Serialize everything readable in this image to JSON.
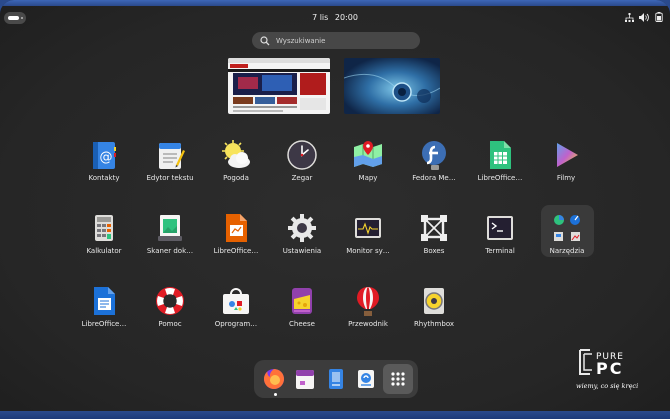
{
  "topbar": {
    "date": "7 lis",
    "time": "20:00",
    "icons": [
      "network-icon",
      "volume-icon",
      "battery-icon"
    ]
  },
  "search": {
    "placeholder": "Wyszukiwanie"
  },
  "apps": [
    {
      "label": "Kontakty",
      "icon": "contacts-icon"
    },
    {
      "label": "Edytor tekstu",
      "icon": "text-editor-icon"
    },
    {
      "label": "Pogoda",
      "icon": "weather-icon"
    },
    {
      "label": "Zegar",
      "icon": "clock-icon"
    },
    {
      "label": "Mapy",
      "icon": "maps-icon"
    },
    {
      "label": "Fedora Me…",
      "icon": "fedora-icon"
    },
    {
      "label": "LibreOffice…",
      "icon": "libreoffice-calc-icon"
    },
    {
      "label": "Filmy",
      "icon": "videos-icon"
    },
    {
      "label": "Kalkulator",
      "icon": "calculator-icon"
    },
    {
      "label": "Skaner dok…",
      "icon": "scanner-icon"
    },
    {
      "label": "LibreOffice…",
      "icon": "libreoffice-impress-icon"
    },
    {
      "label": "Ustawienia",
      "icon": "settings-icon"
    },
    {
      "label": "Monitor sy…",
      "icon": "system-monitor-icon"
    },
    {
      "label": "Boxes",
      "icon": "boxes-icon"
    },
    {
      "label": "Terminal",
      "icon": "terminal-icon"
    },
    {
      "label": "Narzędzia",
      "icon": "utilities-folder-icon"
    },
    {
      "label": "LibreOffice…",
      "icon": "libreoffice-writer-icon"
    },
    {
      "label": "Pomoc",
      "icon": "help-icon"
    },
    {
      "label": "Oprogram…",
      "icon": "software-icon"
    },
    {
      "label": "Cheese",
      "icon": "cheese-icon"
    },
    {
      "label": "Przewodnik",
      "icon": "tour-icon"
    },
    {
      "label": "Rhythmbox",
      "icon": "rhythmbox-icon"
    }
  ],
  "dock": [
    "firefox-icon",
    "calendar-icon",
    "documents-icon",
    "software-icon",
    "app-grid-icon"
  ],
  "watermark": {
    "brand_top": "PURE",
    "brand_bottom": "PC",
    "tagline": "wiemy, co się kręci"
  },
  "colors": {
    "background": "#262626",
    "accent_blue": "#2a4a8c"
  }
}
